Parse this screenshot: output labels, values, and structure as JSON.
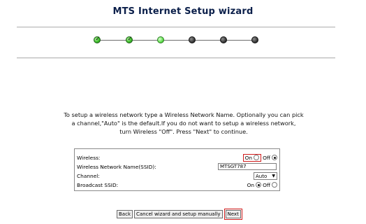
{
  "page": {
    "title": "MTS Internet Setup wizard"
  },
  "progress": {
    "steps": [
      {
        "state": "done",
        "mark": "✓"
      },
      {
        "state": "done",
        "mark": "✓"
      },
      {
        "state": "current",
        "mark": ""
      },
      {
        "state": "todo",
        "mark": ""
      },
      {
        "state": "todo",
        "mark": ""
      },
      {
        "state": "todo",
        "mark": ""
      }
    ],
    "colors": {
      "done": "#3fbf2c",
      "current": "#62e04e",
      "todo": "#3b3b3b"
    }
  },
  "instructions": {
    "line1": "To setup a wireless network type a Wireless Network Name. Optionally you can pick",
    "line2": "a channel,\"Auto\" is the default.If you do not want to setup a wireless network,",
    "line3": "turn Wireless \"Off\". Press \"Next\" to continue."
  },
  "form": {
    "wireless": {
      "label": "Wireless:",
      "on": "On",
      "off": "Off",
      "selected": "off"
    },
    "ssid": {
      "label": "Wireless Network Name(SSID):",
      "value": "MTSGT787"
    },
    "channel": {
      "label": "Channel:",
      "value": "Auto"
    },
    "broadcast": {
      "label": "Broadcast SSID:",
      "on": "On",
      "off": "Off",
      "selected": "on"
    }
  },
  "buttons": {
    "back": "Back",
    "cancel": "Cancel wizard and setup manually",
    "next": "Next"
  },
  "highlight_color": "#d11b1b"
}
